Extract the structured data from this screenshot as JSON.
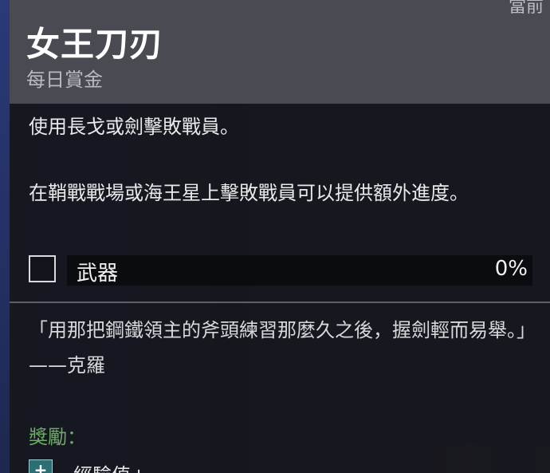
{
  "bounty": {
    "title": "女王刀刃",
    "type": "每日賞金",
    "description_lines": [
      "使用長戈或劍擊敗戰員。",
      "在鞘戰戰場或海王星上擊敗戰員可以提供額外進度。"
    ]
  },
  "objective": {
    "label": "武器",
    "percent_text": "0%",
    "progress": 0,
    "completed": false
  },
  "lore": {
    "quote": "「用那把鋼鐵領主的斧頭練習那麼久之後，握劍輕而易舉。」——克羅"
  },
  "rewards": {
    "heading": "獎勵：",
    "items": [
      {
        "label": "經驗值+",
        "icon": "plus-icon"
      }
    ]
  },
  "background": {
    "top_right_text": "當前"
  },
  "colors": {
    "header_bg": "#4a4b52",
    "rewards_heading": "#6fa86a",
    "progress_fill": "#5c6b3a"
  }
}
